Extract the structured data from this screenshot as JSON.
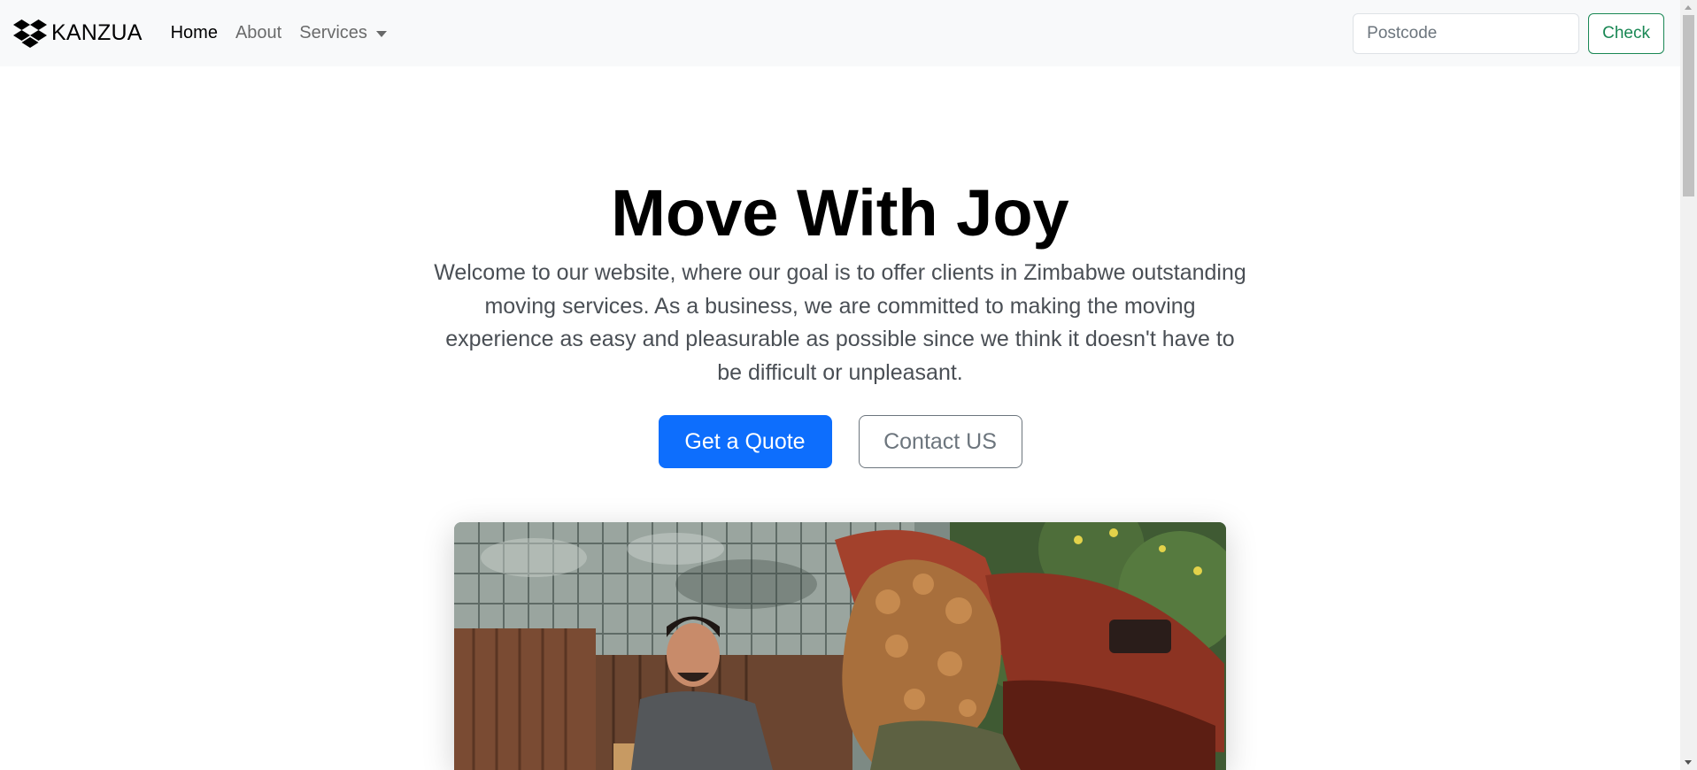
{
  "navbar": {
    "brand": "KANZUA",
    "links": [
      {
        "label": "Home",
        "active": true
      },
      {
        "label": "About",
        "active": false
      },
      {
        "label": "Services",
        "active": false,
        "dropdown": true
      }
    ],
    "search": {
      "placeholder": "Postcode",
      "button_label": "Check"
    }
  },
  "hero": {
    "title": "Move With Joy",
    "lead": "Welcome to our website, where our goal is to offer clients in Zimbabwe outstanding moving services. As a business, we are committed to making the moving experience as easy and pleasurable as possible since we think it doesn't have to be difficult or unpleasant.",
    "primary_button": "Get a Quote",
    "secondary_button": "Contact US"
  },
  "icons": {
    "brand": "dropbox-logo-icon",
    "dropdown": "caret-down-icon"
  },
  "colors": {
    "primary": "#0d6efd",
    "success": "#198754",
    "navbar_bg": "#f8f9fa",
    "secondary": "#6c757d"
  }
}
